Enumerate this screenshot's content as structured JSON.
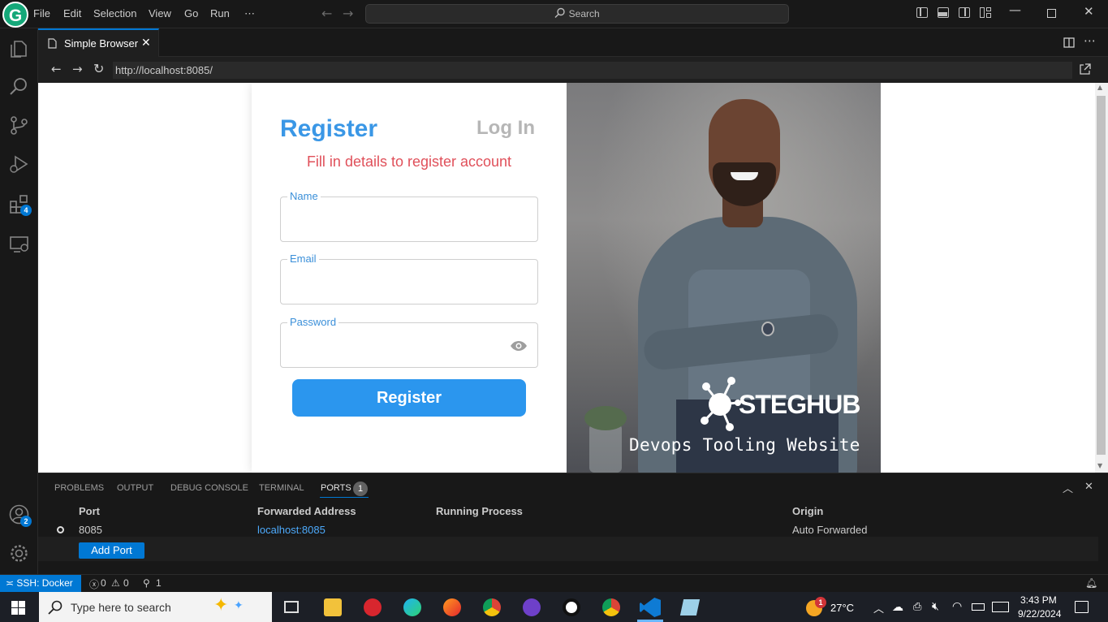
{
  "titlebar": {
    "menu": [
      "File",
      "Edit",
      "Selection",
      "View",
      "Go",
      "Run",
      "⋯"
    ],
    "search_placeholder": "Search"
  },
  "activity": {
    "extensions_badge": "4",
    "accounts_badge": "2"
  },
  "editor": {
    "tab_label": "Simple Browser",
    "url": "http://localhost:8085/"
  },
  "page": {
    "register_title": "Register",
    "login_link": "Log In",
    "subtitle": "Fill in details to register account",
    "fields": {
      "name": "Name",
      "email": "Email",
      "password": "Password"
    },
    "register_button": "Register",
    "brand": "STEGHUB",
    "tagline": "Devops Tooling Website"
  },
  "panel": {
    "tabs": [
      "PROBLEMS",
      "OUTPUT",
      "DEBUG CONSOLE",
      "TERMINAL",
      "PORTS"
    ],
    "ports_count": "1",
    "columns": [
      "Port",
      "Forwarded Address",
      "Running Process",
      "Origin"
    ],
    "rows": [
      {
        "port": "8085",
        "forwarded": "localhost:8085",
        "process": "",
        "origin": "Auto Forwarded"
      }
    ],
    "add_port": "Add Port"
  },
  "statusbar": {
    "remote": "SSH: Docker",
    "errors": "0",
    "warnings": "0",
    "ports": "1"
  },
  "taskbar": {
    "search_placeholder": "Type here to search",
    "weather_badge": "1",
    "temperature": "27°C",
    "time": "3:43 PM",
    "date": "9/22/2024"
  },
  "colors": {
    "accent": "#0078d4",
    "register_blue": "#3a97e6",
    "subtitle_red": "#e0505a",
    "button_blue": "#2b96ee"
  }
}
